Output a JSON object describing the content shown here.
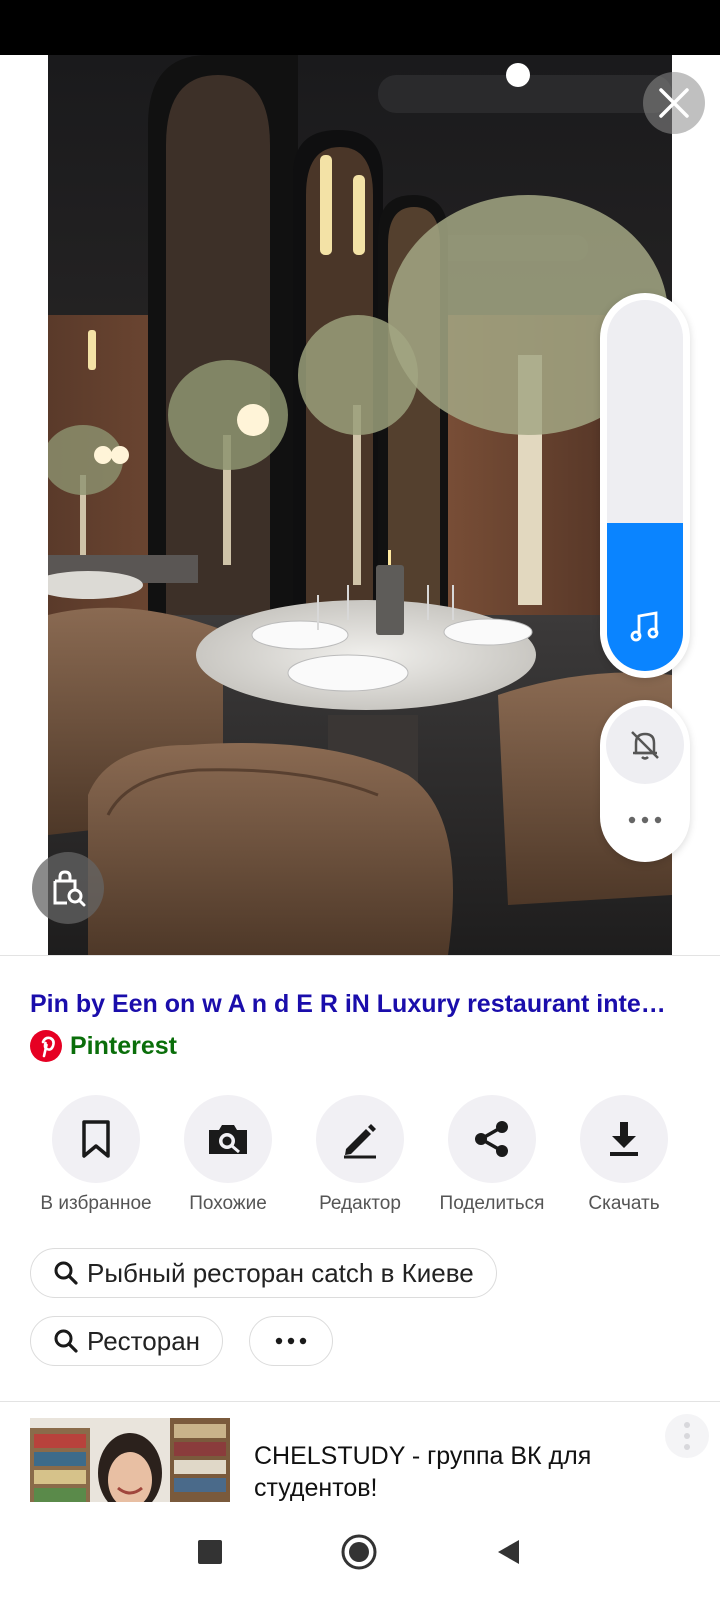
{
  "result": {
    "title": "Pin by Een on w A n d E R iN Luxury restaurant inte…",
    "source_name": "Pinterest",
    "source_icon": "pinterest-icon",
    "link_color": "#1a0dab",
    "source_color": "#0a6e0a"
  },
  "actions": [
    {
      "label": "В избранное",
      "icon": "bookmark-icon"
    },
    {
      "label": "Похожие",
      "icon": "camera-search-icon"
    },
    {
      "label": "Редактор",
      "icon": "pencil-icon"
    },
    {
      "label": "Поделиться",
      "icon": "share-icon"
    },
    {
      "label": "Скачать",
      "icon": "download-icon"
    }
  ],
  "suggestions": [
    {
      "label": "Рыбный ресторан catch в Киеве",
      "icon": "search-icon"
    },
    {
      "label": "Ресторан",
      "icon": "search-icon"
    }
  ],
  "more_chip_icon": "more-horizontal-icon",
  "volume_overlay": {
    "level_fraction": 0.4,
    "accent": "#0a84ff",
    "icon": "music-note-icon",
    "ringer_icon": "bell-off-icon",
    "more_icon": "more-horizontal-icon"
  },
  "related_card": {
    "title": "CHELSTUDY - группа ВК для студентов!"
  },
  "nav": [
    "recents-square-icon",
    "home-circle-icon",
    "back-triangle-icon"
  ]
}
